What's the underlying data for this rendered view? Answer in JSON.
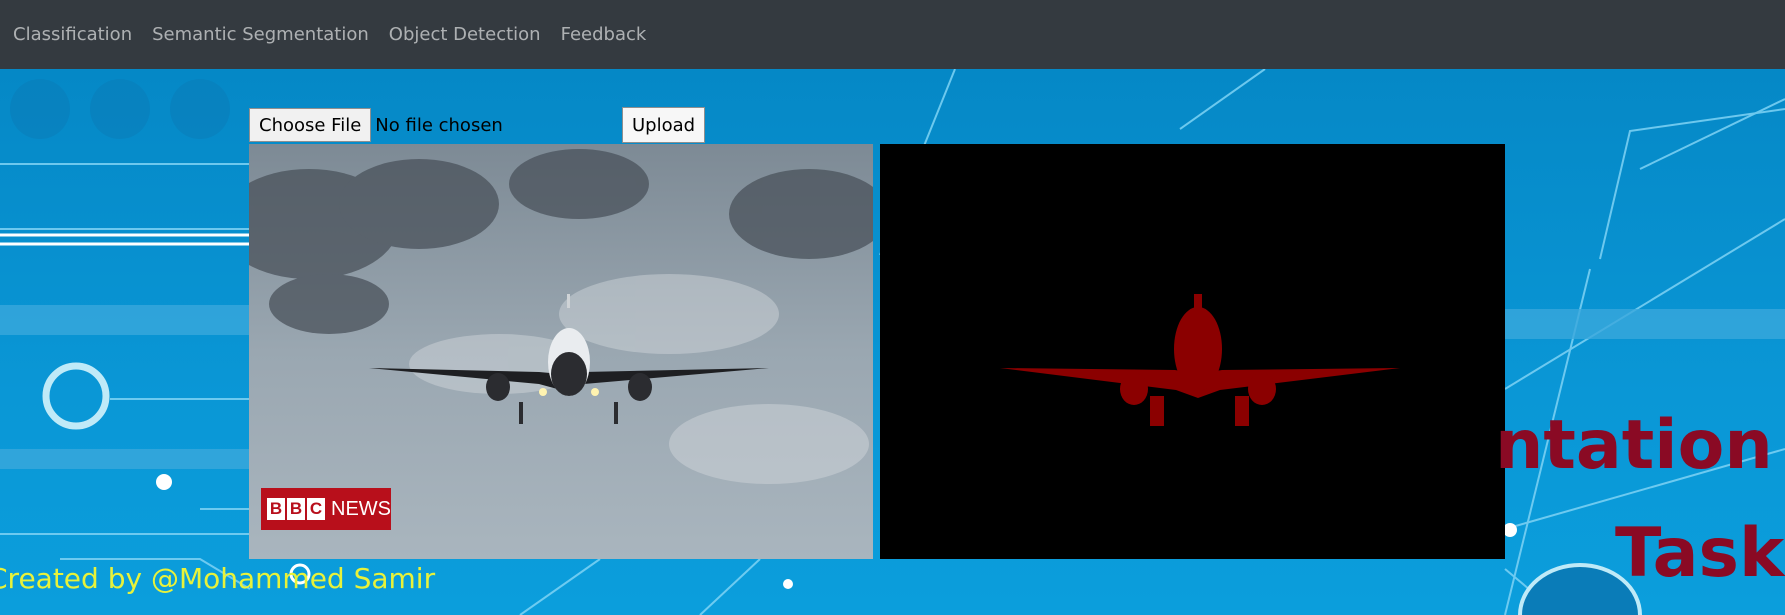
{
  "nav": {
    "items": [
      {
        "label": "Classification"
      },
      {
        "label": "Semantic Segmentation"
      },
      {
        "label": "Object Detection"
      },
      {
        "label": "Feedback"
      }
    ]
  },
  "upload": {
    "choose_label": "Choose File",
    "status": "No file chosen",
    "upload_label": "Upload"
  },
  "images": {
    "input_logo_block_letters": [
      "B",
      "B",
      "C"
    ],
    "input_logo_word": "NEWS"
  },
  "heading": {
    "line1": "ntation",
    "line2": "Task"
  },
  "footer": {
    "credit": "Created by @Mohammed Samir"
  },
  "colors": {
    "navbar": "#343a40",
    "background": "#0592d0",
    "heading": "#8a0a24",
    "credit": "#e8f23a",
    "mask": "#8b0000"
  }
}
